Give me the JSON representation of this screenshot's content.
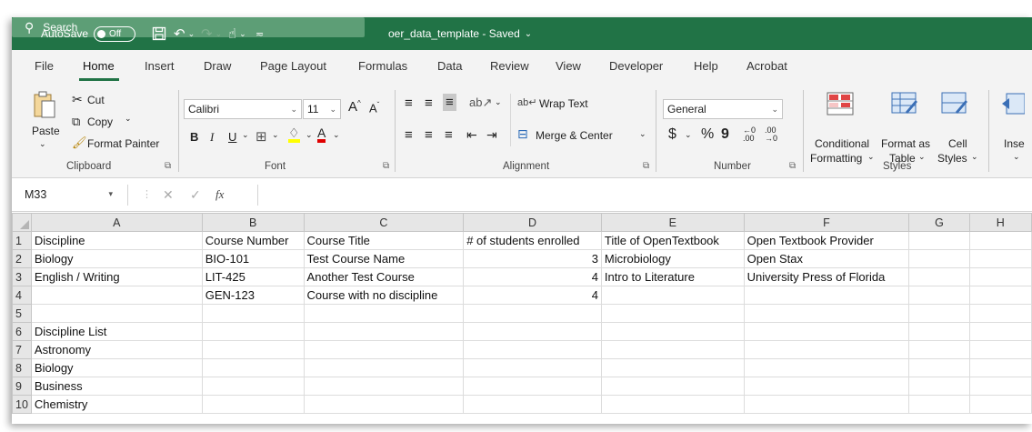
{
  "titlebar": {
    "autosave_label": "AutoSave",
    "autosave_state": "Off",
    "document_title": "oer_data_template - Saved",
    "title_dropdown": "⌄",
    "search_placeholder": "Search"
  },
  "tabs": [
    "File",
    "Home",
    "Insert",
    "Draw",
    "Page Layout",
    "Formulas",
    "Data",
    "Review",
    "View",
    "Developer",
    "Help",
    "Acrobat"
  ],
  "active_tab": "Home",
  "ribbon": {
    "clipboard": {
      "label": "Clipboard",
      "paste": "Paste",
      "cut": "Cut",
      "copy": "Copy",
      "format_painter": "Format Painter"
    },
    "font": {
      "label": "Font",
      "font_name": "Calibri",
      "font_size": "11",
      "bold": "B",
      "italic": "I",
      "underline": "U",
      "grow": "A",
      "shrink": "A",
      "font_color": "A"
    },
    "alignment": {
      "label": "Alignment",
      "wrap_text": "Wrap Text",
      "merge_center": "Merge & Center"
    },
    "number": {
      "label": "Number",
      "format": "General",
      "currency": "$",
      "percent": "%",
      "comma": "9"
    },
    "styles": {
      "label": "Styles",
      "conditional_1": "Conditional",
      "conditional_2": "Formatting",
      "format_table_1": "Format as",
      "format_table_2": "Table",
      "cell_styles_1": "Cell",
      "cell_styles_2": "Styles"
    },
    "cells": {
      "insert": "Inse"
    }
  },
  "formula_bar": {
    "name_box": "M33",
    "fx": "fx",
    "value": ""
  },
  "sheet": {
    "columns": [
      "A",
      "B",
      "C",
      "D",
      "E",
      "F",
      "G",
      "H"
    ],
    "rows": [
      {
        "num": "1",
        "cells": [
          "Discipline",
          "Course Number",
          "Course Title",
          "# of students enrolled",
          "Title of OpenTextbook",
          "Open Textbook Provider",
          "",
          ""
        ]
      },
      {
        "num": "2",
        "cells": [
          "Biology",
          "BIO-101",
          "Test Course Name",
          "3",
          "Microbiology",
          "Open Stax",
          "",
          ""
        ]
      },
      {
        "num": "3",
        "cells": [
          "English / Writing",
          "LIT-425",
          "Another Test Course",
          "4",
          "Intro to Literature",
          "University Press of Florida",
          "",
          ""
        ]
      },
      {
        "num": "4",
        "cells": [
          "",
          "GEN-123",
          "Course with no discipline",
          "4",
          "",
          "",
          "",
          ""
        ]
      },
      {
        "num": "5",
        "cells": [
          "",
          "",
          "",
          "",
          "",
          "",
          "",
          ""
        ]
      },
      {
        "num": "6",
        "cells": [
          "Discipline List",
          "",
          "",
          "",
          "",
          "",
          "",
          ""
        ]
      },
      {
        "num": "7",
        "cells": [
          "Astronomy",
          "",
          "",
          "",
          "",
          "",
          "",
          ""
        ]
      },
      {
        "num": "8",
        "cells": [
          "Biology",
          "",
          "",
          "",
          "",
          "",
          "",
          ""
        ]
      },
      {
        "num": "9",
        "cells": [
          "Business",
          "",
          "",
          "",
          "",
          "",
          "",
          ""
        ]
      },
      {
        "num": "10",
        "cells": [
          "Chemistry",
          "",
          "",
          "",
          "",
          "",
          "",
          ""
        ]
      }
    ]
  },
  "colors": {
    "excel_green": "#217346",
    "ribbon_bg": "#f3f3f3",
    "header_bg": "#e6e6e6"
  }
}
